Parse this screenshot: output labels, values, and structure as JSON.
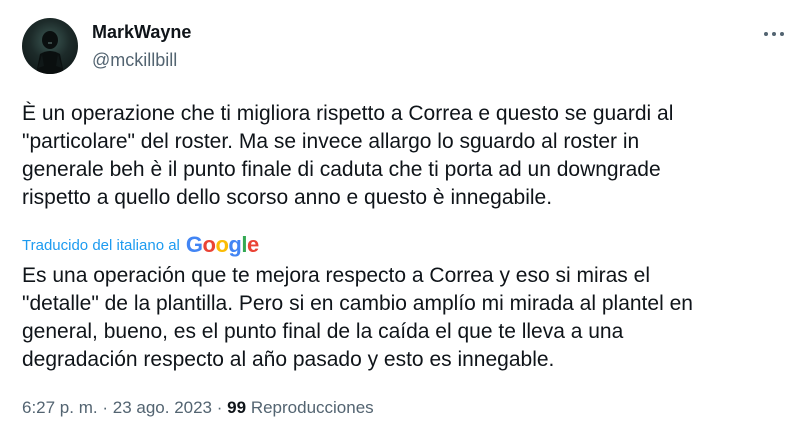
{
  "author": {
    "display_name": "MarkWayne",
    "handle": "@mckillbill",
    "avatar_icon": "user-avatar-icon"
  },
  "tweet": {
    "text": "È un operazione che ti migliora rispetto a Correa e questo se guardi al\n\"particolare\" del roster. Ma se invece allargo lo sguardo al roster in\ngenerale beh è il punto finale di caduta che ti porta ad un downgrade\nrispetto a quello dello scorso anno e questo è innegabile.",
    "translated_text": "Es una operación que te mejora respecto a Correa y eso si miras el\n\"detalle\" de la plantilla. Pero si en cambio amplío mi mirada al plantel en\ngeneral, bueno, es el punto final de la caída el que te lleva a una\ndegradación respecto al año pasado y esto es innegable."
  },
  "translation": {
    "label": "Traducido del italiano al",
    "provider": "Google",
    "provider_letters": [
      "G",
      "o",
      "o",
      "g",
      "l",
      "e"
    ]
  },
  "meta": {
    "time": "6:27 p. m.",
    "separator": "·",
    "date": "23 ago. 2023",
    "view_count": "99",
    "views_label": "Reproducciones"
  },
  "colors": {
    "accent": "#1d9bf0",
    "text": "#0f1419",
    "secondary": "#536471"
  }
}
